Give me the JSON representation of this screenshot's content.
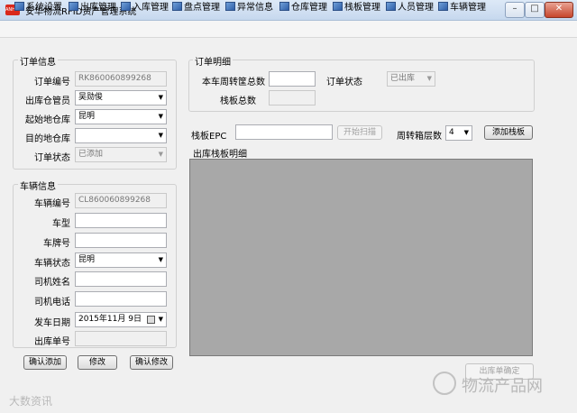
{
  "window": {
    "title": "安华物流RFID资产管理系统",
    "logo_text": "ANHUA",
    "minimize_label": "–",
    "maximize_label": "□",
    "close_label": "✕"
  },
  "menu": [
    {
      "label": "系统设置",
      "icon": "settings-icon"
    },
    {
      "label": "出库管理",
      "icon": "outbound-icon"
    },
    {
      "label": "入库管理",
      "icon": "inbound-icon"
    },
    {
      "label": "盘点管理",
      "icon": "inventory-icon"
    },
    {
      "label": "异常信息",
      "icon": "exception-icon"
    },
    {
      "label": "仓库管理",
      "icon": "warehouse-icon"
    },
    {
      "label": "栈板管理",
      "icon": "pallet-icon"
    },
    {
      "label": "人员管理",
      "icon": "personnel-icon"
    },
    {
      "label": "车辆管理",
      "icon": "vehicle-icon"
    }
  ],
  "order_info": {
    "title": "订单信息",
    "order_no_label": "订单编号",
    "order_no_value": "RK860060899268",
    "keeper_label": "出库仓管员",
    "keeper_value": "吴勋俊",
    "origin_label": "起始地仓库",
    "origin_value": "昆明",
    "dest_label": "目的地仓库",
    "dest_value": "",
    "status_label": "订单状态",
    "status_value": "已添加"
  },
  "vehicle_info": {
    "title": "车辆信息",
    "vehicle_no_label": "车辆编号",
    "vehicle_no_value": "CL860060899268",
    "model_label": "车型",
    "model_value": "",
    "plate_label": "车牌号",
    "plate_value": "",
    "status_label": "车辆状态",
    "status_value": "昆明",
    "driver_label": "司机姓名",
    "driver_value": "",
    "phone_label": "司机电话",
    "phone_value": "",
    "date_label": "发车日期",
    "date_value": "2015年11月 9日",
    "outbound_no_label": "出库单号",
    "outbound_no_value": ""
  },
  "buttons": {
    "confirm_add": "确认添加",
    "modify": "修改",
    "confirm_modify": "确认修改",
    "start_scan": "开始扫描",
    "add_pallet": "添加栈板",
    "outbound_confirm": "出库单确定"
  },
  "order_detail": {
    "title": "订单明细",
    "crate_total_label": "本车周转筐总数",
    "crate_total_value": "",
    "order_status_label": "订单状态",
    "order_status_value": "已出库",
    "pallet_total_label": "栈板总数",
    "pallet_total_value": ""
  },
  "pallet_entry": {
    "epc_label": "栈板EPC",
    "epc_value": "",
    "layers_label": "周转箱层数",
    "layers_value": "4"
  },
  "pallet_list": {
    "title": "出库栈板明细"
  },
  "watermarks": {
    "left": "大数资讯",
    "right": "物流产品网"
  }
}
